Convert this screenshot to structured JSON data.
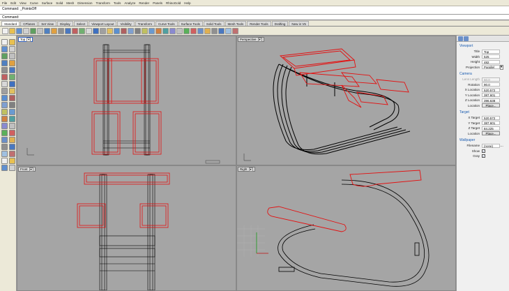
{
  "menubar": [
    "File",
    "Edit",
    "View",
    "Curve",
    "Surface",
    "Solid",
    "Mesh",
    "Dimension",
    "Transform",
    "Tools",
    "Analyze",
    "Render",
    "Panels",
    "RhinoGold",
    "Help"
  ],
  "command": {
    "history": "Command: _PointsOff",
    "prompt": "Command:"
  },
  "tabs": [
    "Standard",
    "CPlanes",
    "Set View",
    "Display",
    "Select",
    "Viewport Layout",
    "Visibility",
    "Transform",
    "Curve Tools",
    "Surface Tools",
    "Solid Tools",
    "Mesh Tools",
    "Render Tools",
    "Drafting",
    "New in V5"
  ],
  "active_tab": "Standard",
  "viewports": {
    "top": "Top",
    "perspective": "Perspective",
    "front": "Front",
    "right": "Right"
  },
  "properties": {
    "viewport_header": "Viewport",
    "title_label": "Title",
    "title_value": "Top",
    "width_label": "Width",
    "width_value": "525",
    "height_label": "Height",
    "height_value": "482",
    "projection_label": "Projection",
    "projection_value": "Parallel",
    "camera_header": "Camera",
    "lens_label": "Lens Length",
    "lens_value": "50.0",
    "rotation_label": "Rotation",
    "rotation_value": "90.0",
    "xloc_label": "X Location",
    "xloc_value": "520.572",
    "yloc_label": "Y Location",
    "yloc_value": "387.601",
    "zloc_label": "Z Location",
    "zloc_value": "396.638",
    "location_label": "Location",
    "place_label": "Place...",
    "target_header": "Target",
    "xt_label": "X Target",
    "xt_value": "520.572",
    "yt_label": "Y Target",
    "yt_value": "387.601",
    "zt_label": "Z Target",
    "zt_value": "84.225",
    "tloc_label": "Location",
    "tplace_label": "Place...",
    "wallpaper_header": "Wallpaper",
    "filename_label": "Filename",
    "filename_value": "(none)",
    "show_label": "Show",
    "gray_label": "Gray"
  }
}
